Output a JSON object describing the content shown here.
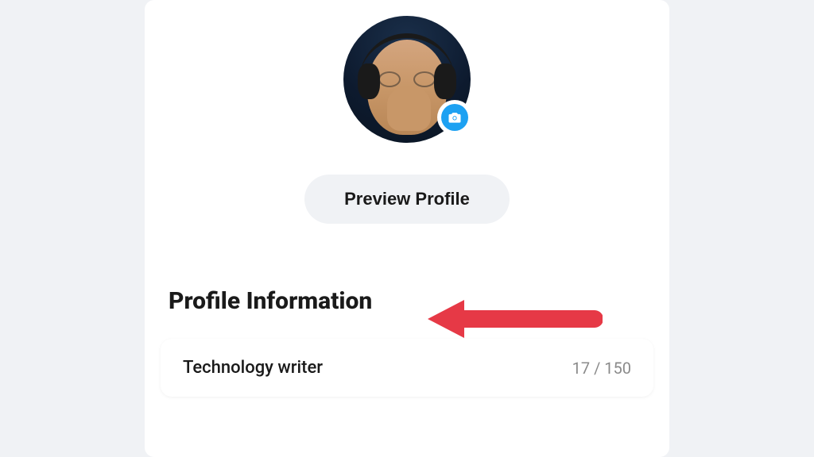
{
  "profile": {
    "preview_button_label": "Preview Profile",
    "section_heading": "Profile Information",
    "bio_value": "Technology writer",
    "bio_char_count": "17 / 150"
  },
  "icons": {
    "camera_add": "camera-add-icon",
    "arrow": "arrow-left-icon"
  },
  "colors": {
    "accent": "#1da1f2",
    "arrow": "#e63946",
    "page_bg": "#f0f2f5",
    "card_bg": "#ffffff"
  }
}
